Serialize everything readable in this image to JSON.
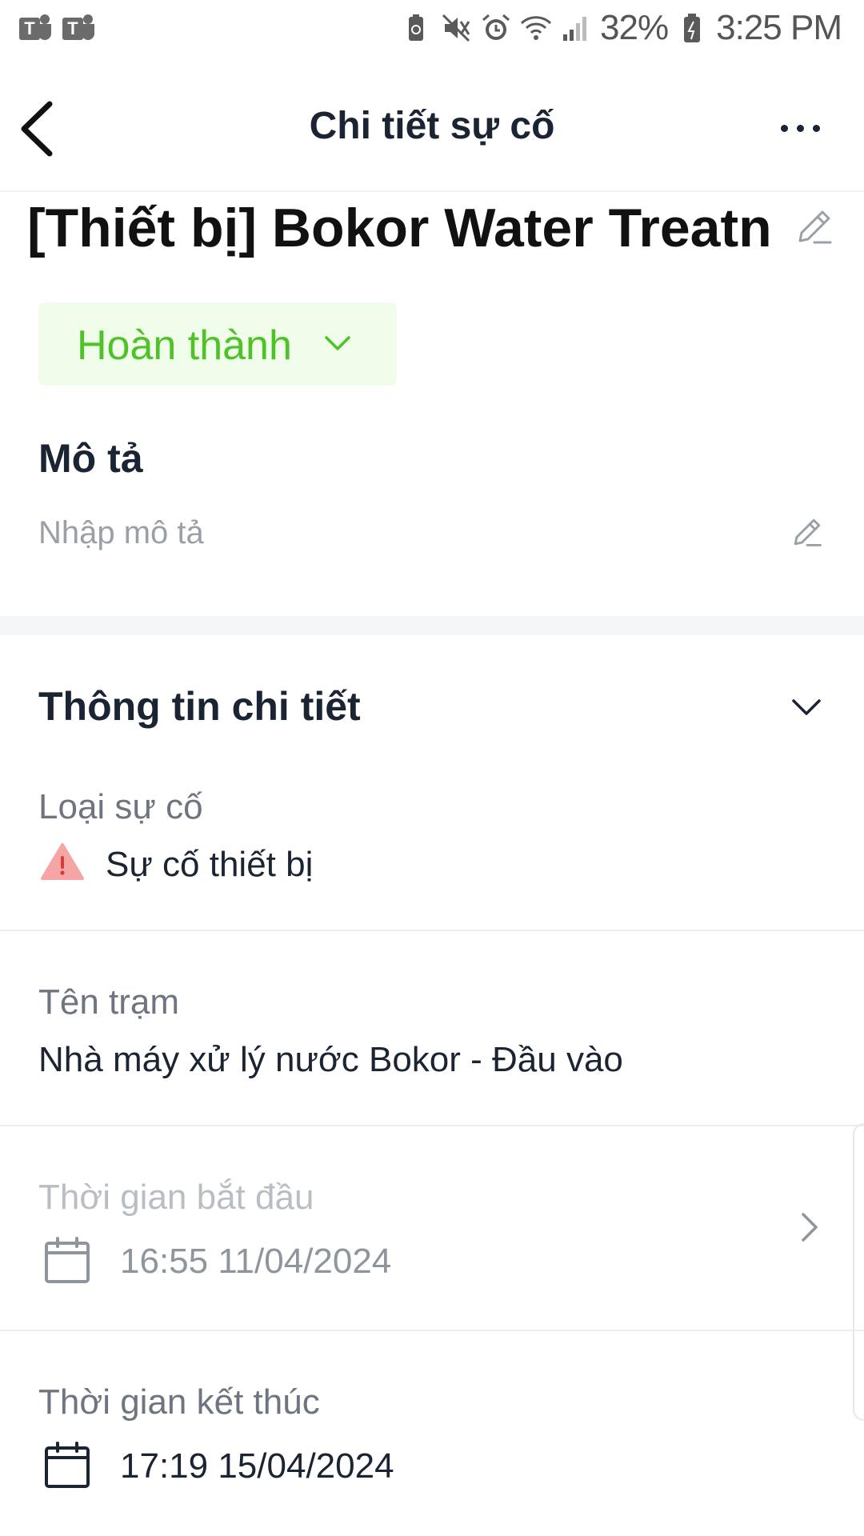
{
  "status_bar": {
    "battery": "32%",
    "time": "3:25 PM",
    "icons": [
      "teams-icon",
      "teams-icon",
      "battery-saver-icon",
      "mute-icon",
      "alarm-icon",
      "wifi-icon",
      "signal-icon",
      "battery-icon"
    ]
  },
  "header": {
    "title": "Chi tiết sự cố"
  },
  "incident": {
    "title": "[Thiết bị] Bokor Water Treatn"
  },
  "status": {
    "selected": "Hoàn thành",
    "color": "#4fc227"
  },
  "description": {
    "label": "Mô tả",
    "placeholder": "Nhập mô tả"
  },
  "details": {
    "label": "Thông tin chi tiết",
    "incident_type": {
      "label": "Loại sự cố",
      "value": "Sự cố thiết bị"
    },
    "station": {
      "label": "Tên trạm",
      "value": "Nhà máy xử lý nước Bokor - Đầu vào"
    },
    "start_time": {
      "label": "Thời gian bắt đầu",
      "value": "16:55 11/04/2024"
    },
    "end_time": {
      "label": "Thời gian kết thúc",
      "value": "17:19 15/04/2024"
    }
  }
}
